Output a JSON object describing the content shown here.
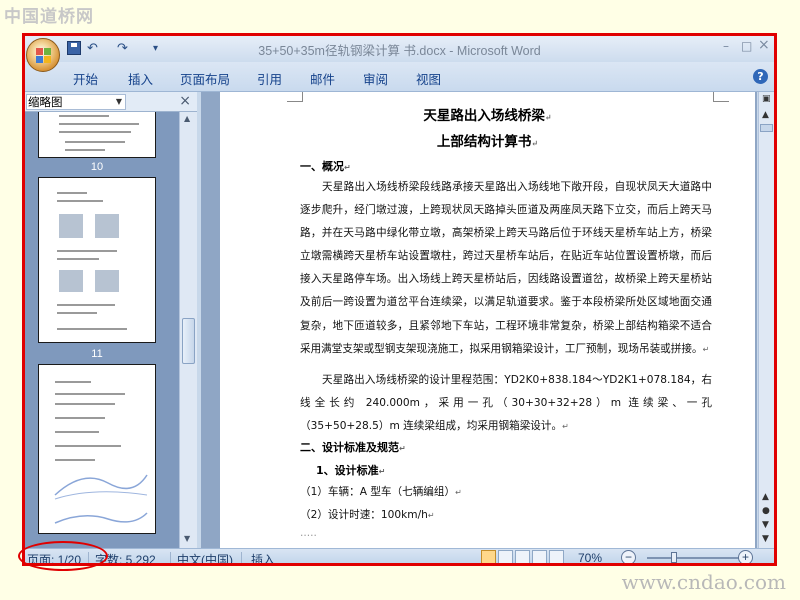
{
  "watermarks": {
    "top": "中国道桥网",
    "bottom": "www.cndao.com"
  },
  "window": {
    "title": "35+50+35m径轨钢梁计算 书.docx - Microsoft Word",
    "controls": {
      "minimize": "–",
      "maximize": "□",
      "close": "×"
    }
  },
  "quick_access": {
    "undo": "↶",
    "redo": "↷",
    "more": "▾"
  },
  "ribbon_tabs": [
    "开始",
    "插入",
    "页面布局",
    "引用",
    "邮件",
    "审阅",
    "视图"
  ],
  "help": "?",
  "thumbnail_pane": {
    "view_select": "缩略图",
    "close": "×",
    "page_numbers": [
      "10",
      "11"
    ]
  },
  "document": {
    "title1": "天星路出入场线桥梁",
    "title2": "上部结构计算书",
    "h1": "一、概况",
    "p1": "天星路出入场线桥梁段线路承接天星路出入场线地下敞开段，自现状凤天大道路中逐步爬升，经门墩过渡，上跨现状凤天路掉头匝道及两座凤天路下立交，而后上跨天马路，并在天马路中绿化带立墩，高架桥梁上跨天马路后位于环线天星桥车站上方，桥梁立墩需横跨天星桥车站设置墩柱，跨过天星桥车站后，在贴近车站位置设置桥墩，而后接入天星路停车场。出入场线上跨天星桥站后，因线路设置道岔，故桥梁上跨天星桥站及前后一跨设置为道岔平台连续梁，以满足轨道要求。鉴于本段桥梁所处区域地面交通复杂，地下匝道较多，且紧邻地下车站，工程环境非常复杂，桥梁上部结构箱梁不适合采用满堂支架或型钢支架现浇施工，拟采用钢箱梁设计，工厂预制，现场吊装或拼接。",
    "p2": "天星路出入场线桥梁的设计里程范围：YD2K0+838.184～YD2K1+078.184，右线全长约 240.000m，采用一孔（30+30+32+28）m 连续梁、一孔（35+50+28.5）m 连续梁组成，均采用钢箱梁设计。",
    "h2": "二、设计标准及规范",
    "h3": "1、设计标准",
    "l1": "（1）车辆：A 型车（七辆编组）",
    "l2": "（2）设计时速：100km/h"
  },
  "status": {
    "page": "页面: 1/20",
    "words": "字数: 5,292",
    "language": "中文(中国)",
    "mode": "插入",
    "zoom": "70%",
    "zoom_minus": "−",
    "zoom_plus": "+"
  },
  "colors": {
    "annotation_red": "#e00000",
    "ribbon_text": "#15428b"
  }
}
